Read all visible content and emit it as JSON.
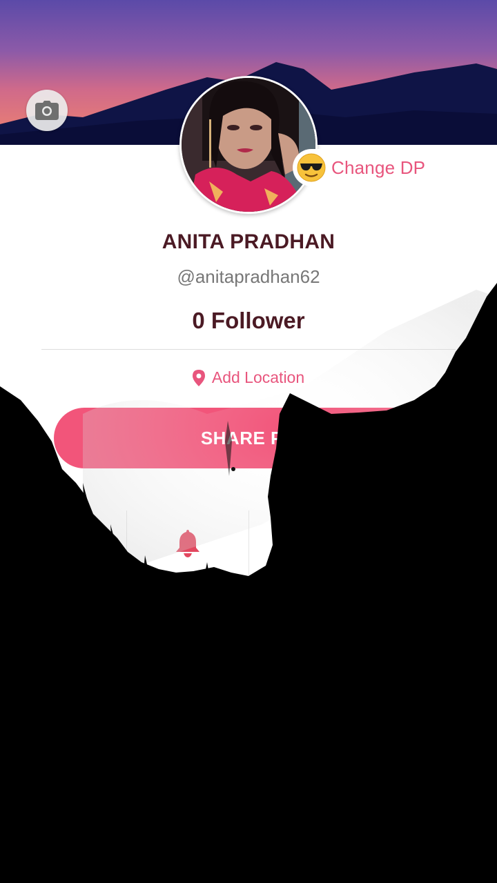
{
  "profile": {
    "name": "ANITA PRADHAN",
    "handle": "@anitapradhan62",
    "followers": "0 Follower",
    "change_dp_label": "Change DP",
    "add_location_label": "Add Location",
    "share_button_label": "SHARE PR"
  },
  "icons": {
    "camera": "camera-icon",
    "emoji": "sunglasses-emoji-icon",
    "location": "location-pin-icon",
    "bell": "bell-icon"
  },
  "colors": {
    "accent": "#f2557a",
    "accent_text": "#e8557d",
    "name_text": "#4b1a24",
    "handle_text": "#777777"
  }
}
